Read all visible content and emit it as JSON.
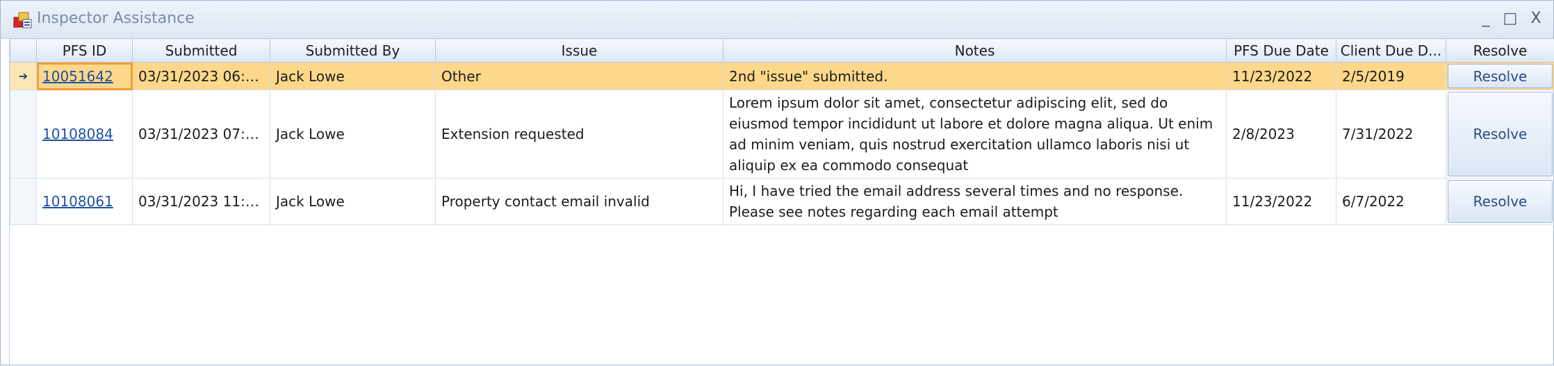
{
  "window": {
    "title": "Inspector Assistance",
    "minimize_glyph": "_",
    "maximize_glyph": "□",
    "close_glyph": "X"
  },
  "grid": {
    "columns": [
      "PFS ID",
      "Submitted",
      "Submitted By",
      "Issue",
      "Notes",
      "PFS Due Date",
      "Client Due D...",
      "Resolve"
    ],
    "current_row_glyph": "➔",
    "rows": [
      {
        "pfs_id": "10051642",
        "submitted": "03/31/2023  06:3...",
        "submitted_by": "Jack Lowe",
        "issue": "Other",
        "notes": "2nd \"issue\" submitted.",
        "pfs_due_date": "11/23/2022",
        "client_due_date": "2/5/2019",
        "resolve_label": "Resolve"
      },
      {
        "pfs_id": "10108084",
        "submitted": "03/31/2023  07:2...",
        "submitted_by": "Jack Lowe",
        "issue": "Extension requested",
        "notes": "Lorem ipsum dolor sit amet, consectetur adipiscing elit, sed do eiusmod tempor incididunt ut labore et dolore magna aliqua. Ut enim ad minim veniam, quis nostrud exercitation ullamco laboris nisi ut aliquip ex ea commodo consequat",
        "pfs_due_date": "2/8/2023",
        "client_due_date": "7/31/2022",
        "resolve_label": "Resolve"
      },
      {
        "pfs_id": "10108061",
        "submitted": "03/31/2023  11:5...",
        "submitted_by": "Jack Lowe",
        "issue": "Property contact email invalid",
        "notes": "Hi, I have tried the email address several times and no response. Please see notes regarding each email attempt",
        "pfs_due_date": "11/23/2022",
        "client_due_date": "6/7/2022",
        "resolve_label": "Resolve"
      }
    ]
  },
  "colors": {
    "selected_row": "#fdd88a",
    "focus_outline": "#f29b3a",
    "link": "#1f4fa6",
    "title_text": "#7b8ba3"
  },
  "icons": {
    "app": "app-icon",
    "row_indicator": "arrow-right-icon"
  }
}
